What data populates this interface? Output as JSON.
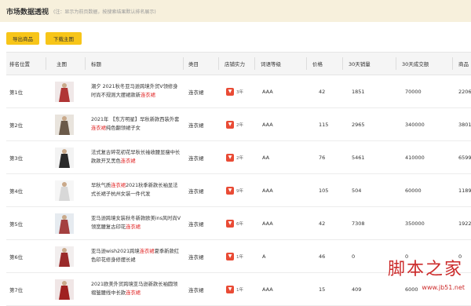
{
  "header": {
    "title": "市场数据透视",
    "hint": "(注：显示为前页数据，按搜索结果默认排名展示)"
  },
  "toolbar": {
    "export_label": "导出商品",
    "download_label": "下载主图"
  },
  "table": {
    "columns": [
      "排名位置",
      "主图",
      "标题",
      "类目",
      "店铺实力",
      "词语等级",
      "价格",
      "30天销量",
      "30天成交额",
      "商品"
    ],
    "rows": [
      {
        "rank": "第1位",
        "title_pre": "潮夕 2021秋冬亚马逊跨境外贸V领修身时尚不规则大摆裙款新",
        "title_hl": "连衣裙",
        "title_post": "",
        "category": "连衣裙",
        "badge": "3年",
        "grade": "AAA",
        "price": "42",
        "sales": "1851",
        "revenue": "70000",
        "extra": "2206",
        "c1": "#f0e8e8",
        "c2": "#b03535"
      },
      {
        "rank": "第2位",
        "title_pre": "2021年 【东方明星】早秋新款西装外套",
        "title_hl": "连衣裙",
        "title_post": "纯色翻领裙子女",
        "category": "连衣裙",
        "badge": "2年",
        "grade": "AAA",
        "price": "115",
        "sales": "2965",
        "revenue": "340000",
        "extra": "3801",
        "c1": "#e9e4dd",
        "c2": "#6b5a4a"
      },
      {
        "rank": "第3位",
        "title_pre": "法式复古碎花初花早秋长袖收腰显瘦中长款款开叉黑色",
        "title_hl": "连衣裙",
        "title_post": "",
        "category": "连衣裙",
        "badge": "2年",
        "grade": "AA",
        "price": "76",
        "sales": "5461",
        "revenue": "410000",
        "extra": "6599",
        "c1": "#f3f3f3",
        "c2": "#2a2a2a"
      },
      {
        "rank": "第4位",
        "title_pre": "早秋气质",
        "title_hl": "连衣裙",
        "title_post": "2021秋季新款长袖显法式长裙子杭州女装一件代发",
        "category": "连衣裙",
        "badge": "9年",
        "grade": "AAA",
        "price": "105",
        "sales": "504",
        "revenue": "60000",
        "extra": "1189",
        "c1": "#f6f6f6",
        "c2": "#d8d8d8"
      },
      {
        "rank": "第5位",
        "title_pre": "亚马逊跨境女装秋冬新款欧美ins风时尚V领宽腰复古印花",
        "title_hl": "连衣裙",
        "title_post": "",
        "category": "连衣裙",
        "badge": "6年",
        "grade": "AAA",
        "price": "42",
        "sales": "7308",
        "revenue": "350000",
        "extra": "1922",
        "c1": "#e6ebf0",
        "c2": "#a44040"
      },
      {
        "rank": "第6位",
        "title_pre": "亚马逊wish2021跨境",
        "title_hl": "连衣裙",
        "title_post": "夏季新款红色印花修身修摆长裙",
        "category": "连衣裙",
        "badge": "1年",
        "grade": "A",
        "price": "46",
        "sales": "0",
        "revenue": "0",
        "extra": "0",
        "c1": "#f2eeee",
        "c2": "#9a2a2a"
      },
      {
        "rank": "第7位",
        "title_pre": "2021欧美外贸跨境亚马逊新款长袖圆领褶皱腰线中长款",
        "title_hl": "连衣裙",
        "title_post": "",
        "category": "连衣裙",
        "badge": "1年",
        "grade": "AAA",
        "price": "15",
        "sales": "409",
        "revenue": "6000",
        "extra": "",
        "c1": "#f0e6e6",
        "c2": "#a02020"
      }
    ]
  },
  "watermark": {
    "text": "脚本之家",
    "url": "www.jb51.net"
  }
}
